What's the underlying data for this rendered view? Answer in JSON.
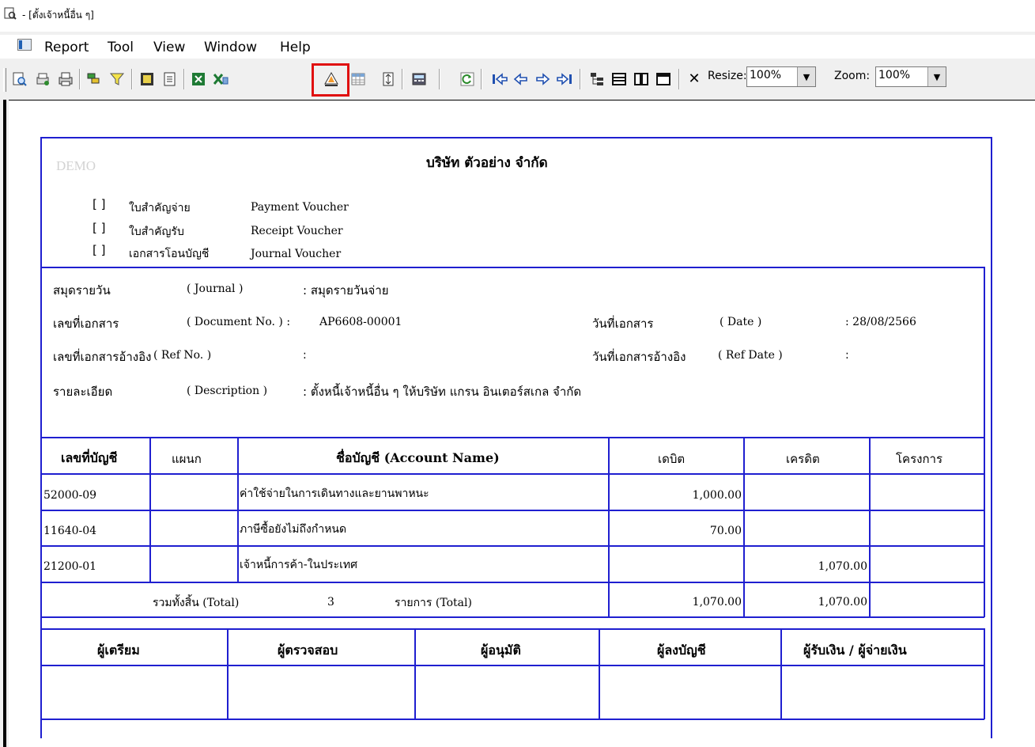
{
  "window": {
    "title": "- [ตั้งเจ้าหนี้อื่น ๆ]"
  },
  "menu": [
    "Report",
    "Tool",
    "View",
    "Window",
    "Help"
  ],
  "toolbar": {
    "resize_label": "Resize:",
    "resize_value": "100%",
    "zoom_label": "Zoom:",
    "zoom_value": "100%",
    "icons": [
      "preview-icon",
      "print-setup-icon",
      "print-icon",
      "group-icon",
      "filter-icon",
      "export-icon",
      "page-setup-icon",
      "excel-icon",
      "excel-export-icon",
      "field-chooser-icon",
      "grid-icon",
      "row-height-icon",
      "calculator-icon",
      "refresh-icon",
      "first-page-icon",
      "prev-page-icon",
      "next-page-icon",
      "last-page-icon",
      "tree-icon",
      "rows-icon",
      "columns-icon",
      "window-icon",
      "close-icon"
    ]
  },
  "report": {
    "watermark": "DEMO",
    "company": "บริษัท ตัวอย่าง จำกัด",
    "voucher_types": [
      {
        "box": "[ ]",
        "th": "ใบสำคัญจ่าย",
        "en": "Payment Voucher"
      },
      {
        "box": "[ ]",
        "th": "ใบสำคัญรับ",
        "en": "Receipt Voucher"
      },
      {
        "box": "[ ]",
        "th": "เอกสารโอนบัญชี",
        "en": "Journal Voucher"
      }
    ],
    "info": {
      "journal_label": "สมุดรายวัน",
      "journal_en": "( Journal )",
      "journal_value": ": สมุดรายวันจ่าย",
      "docno_label": "เลขที่เอกสาร",
      "docno_en": "( Document No. ) :",
      "docno_value": "AP6608-00001",
      "refno_label": "เลขที่เอกสารอ้างอิง",
      "refno_en": "( Ref No. )",
      "refno_value": ":",
      "desc_label": "รายละเอียด",
      "desc_en": "( Description )",
      "desc_value": ":  ตั้งหนี้เจ้าหนี้อื่น ๆ ให้บริษัท แกรน อินเตอร์สเกล จำกัด",
      "date_label": "วันที่เอกสาร",
      "date_en": "( Date )",
      "date_value": ":   28/08/2566",
      "refdate_label": "วันที่เอกสารอ้างอิง",
      "refdate_en": "( Ref Date )",
      "refdate_value": ":"
    },
    "table": {
      "headers": [
        "เลขที่บัญชี",
        "แผนก",
        "ชื่อบัญชี (Account Name)",
        "เดบิต",
        "เครดิต",
        "โครงการ"
      ],
      "rows": [
        {
          "account": "52000-09",
          "dept": "",
          "name": "ค่าใช้จ่ายในการเดินทางและยานพาหนะ",
          "debit": "1,000.00",
          "credit": "",
          "project": ""
        },
        {
          "account": "11640-04",
          "dept": "",
          "name": "ภาษีซื้อยังไม่ถึงกำหนด",
          "debit": "70.00",
          "credit": "",
          "project": ""
        },
        {
          "account": "21200-01",
          "dept": "",
          "name": "เจ้าหนี้การค้า-ในประเทศ",
          "debit": "",
          "credit": "1,070.00",
          "project": ""
        }
      ],
      "total": {
        "label": "รวมทั้งสิ้น (Total)",
        "count": "3",
        "items_label": "รายการ (Total)",
        "debit": "1,070.00",
        "credit": "1,070.00"
      }
    },
    "signatures": [
      "ผู้เตรียม",
      "ผู้ตรวจสอบ",
      "ผู้อนุมัติ",
      "ผู้ลงบัญชี",
      "ผู้รับเงิน / ผู้จ่ายเงิน"
    ]
  }
}
